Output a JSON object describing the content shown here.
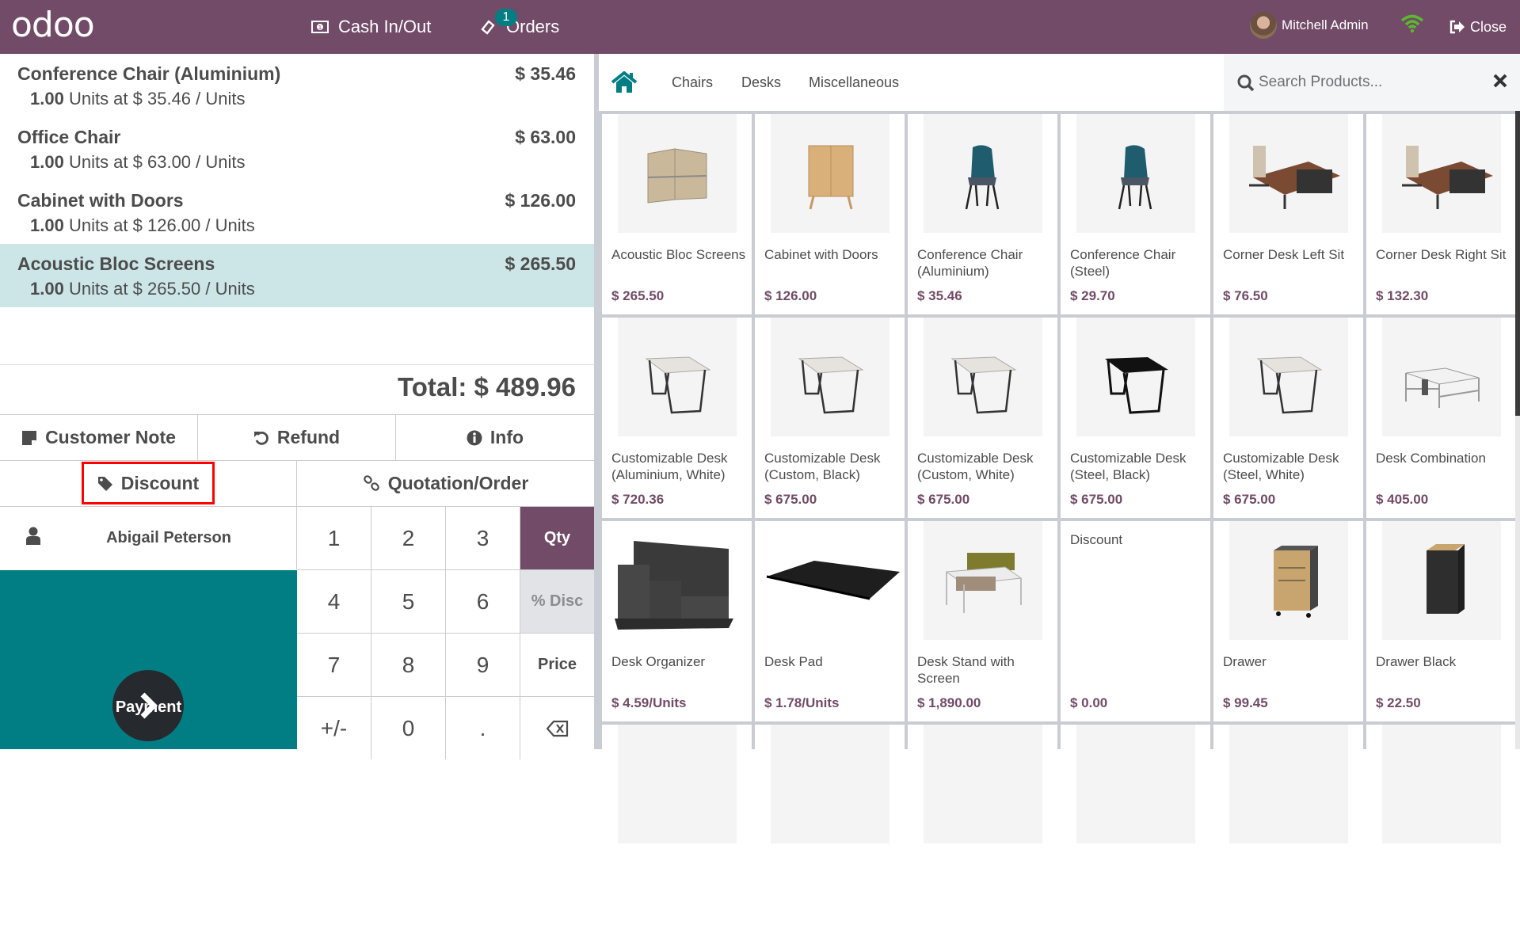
{
  "header": {
    "logo": "odoo",
    "cash_label": "Cash In/Out",
    "orders_label": "Orders",
    "orders_badge": "1",
    "user_name": "Mitchell Admin",
    "close_label": "Close",
    "colors": {
      "primary": "#714b67",
      "accent": "#017e84",
      "wifi": "#5cb82f"
    }
  },
  "order": {
    "lines": [
      {
        "name": "Conference Chair (Aluminium)",
        "total": "$ 35.46",
        "qty": "1.00",
        "info": " Units at $ 35.46 / Units",
        "selected": false
      },
      {
        "name": "Office Chair",
        "total": "$ 63.00",
        "qty": "1.00",
        "info": " Units at $ 63.00 / Units",
        "selected": false
      },
      {
        "name": "Cabinet with Doors",
        "total": "$ 126.00",
        "qty": "1.00",
        "info": " Units at $ 126.00 / Units",
        "selected": false
      },
      {
        "name": "Acoustic Bloc Screens",
        "total": "$ 265.50",
        "qty": "1.00",
        "info": " Units at $ 265.50 / Units",
        "selected": true
      }
    ],
    "total": "Total: $ 489.96"
  },
  "controls": {
    "customer_note": "Customer Note",
    "refund": "Refund",
    "info": "Info",
    "discount": "Discount",
    "quotation": "Quotation/Order",
    "customer": "Abigail Peterson",
    "payment": "Payment"
  },
  "numpad": {
    "keys": [
      "1",
      "2",
      "3",
      "Qty",
      "4",
      "5",
      "6",
      "% Disc",
      "7",
      "8",
      "9",
      "Price",
      "+/-",
      "0",
      ".",
      "⌫"
    ],
    "active_mode": "Qty",
    "disabled_mode": "% Disc"
  },
  "categories": {
    "items": [
      "Chairs",
      "Desks",
      "Miscellaneous"
    ]
  },
  "search": {
    "placeholder": "Search Products..."
  },
  "products": [
    {
      "name": "Acoustic Bloc Screens",
      "price": "$ 265.50",
      "img": "screen"
    },
    {
      "name": "Cabinet with Doors",
      "price": "$ 126.00",
      "img": "cabinet"
    },
    {
      "name": "Conference Chair (Aluminium)",
      "price": "$ 35.46",
      "img": "chair"
    },
    {
      "name": "Conference Chair (Steel)",
      "price": "$ 29.70",
      "img": "chair"
    },
    {
      "name": "Corner Desk Left Sit",
      "price": "$ 76.50",
      "img": "corner"
    },
    {
      "name": "Corner Desk Right Sit",
      "price": "$ 132.30",
      "img": "corner"
    },
    {
      "name": "Customizable Desk (Aluminium, White)",
      "price": "$ 720.36",
      "img": "desk-white"
    },
    {
      "name": "Customizable Desk (Custom, Black)",
      "price": "$ 675.00",
      "img": "desk-white"
    },
    {
      "name": "Customizable Desk (Custom, White)",
      "price": "$ 675.00",
      "img": "desk-white"
    },
    {
      "name": "Customizable Desk (Steel, Black)",
      "price": "$ 675.00",
      "img": "desk-black"
    },
    {
      "name": "Customizable Desk (Steel, White)",
      "price": "$ 675.00",
      "img": "desk-white"
    },
    {
      "name": "Desk Combination",
      "price": "$ 405.00",
      "img": "combo"
    },
    {
      "name": "Desk Organizer",
      "price": "$ 4.59/Units",
      "img": "organizer"
    },
    {
      "name": "Desk Pad",
      "price": "$ 1.78/Units",
      "img": "pad"
    },
    {
      "name": "Desk Stand with Screen",
      "price": "$ 1,890.00",
      "img": "stand"
    },
    {
      "name": "Discount",
      "price": "$ 0.00",
      "img": "none"
    },
    {
      "name": "Drawer",
      "price": "$ 99.45",
      "img": "drawer"
    },
    {
      "name": "Drawer Black",
      "price": "$ 22.50",
      "img": "drawer-black"
    }
  ]
}
